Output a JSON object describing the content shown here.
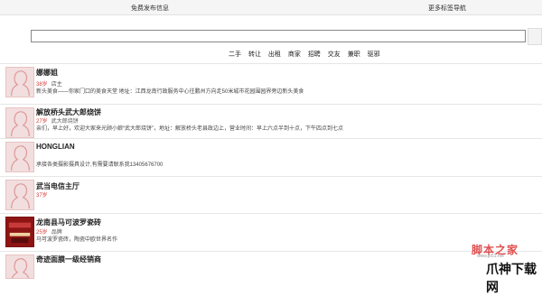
{
  "topbar": {
    "left_link": "免费发布信息",
    "right_link": "更多标签导航"
  },
  "search": {
    "value": "",
    "placeholder": ""
  },
  "categories": [
    "二手",
    "转让",
    "出租",
    "商家",
    "招聘",
    "交友",
    "兼职",
    "驱邪"
  ],
  "items": [
    {
      "title": "娜娜姐",
      "age": "38岁",
      "tag": "店主",
      "desc": "新头美食——你家门口的美食天堂 地址：江西龙南行政服务中心往鹏州方向走50米城市花园围园界旁边新头美食",
      "avatar": "female-silhouette"
    },
    {
      "title": "解放桥头武大郎烧饼",
      "age": "27岁",
      "tag": "武大郎烧饼",
      "desc": "亲们，早上好，欢迎大家来光顾小娘“武大郎烧饼”，地址：解放桥头老县政边上，营业时间：早上六点半到十点，下午四点到七点",
      "avatar": "female-silhouette"
    },
    {
      "title": "HONGLIAN",
      "age": "",
      "tag": "",
      "desc": "承接各类摄影摄具设计,有需要请联系我13405676700",
      "avatar": "female-silhouette"
    },
    {
      "title": "武当电信主厅",
      "age": "37岁",
      "tag": "",
      "desc": "",
      "avatar": "female-silhouette"
    },
    {
      "title": "龙南县马可波罗瓷砖",
      "age": "25岁",
      "tag": "品牌",
      "desc": "马可波罗瓷砖，陶瓷中欧世界名作",
      "avatar": "shop-photo"
    },
    {
      "title": "奇迹面膜一级经销商",
      "age": "",
      "tag": "",
      "desc": "",
      "avatar": "female-silhouette"
    }
  ],
  "watermarks": {
    "site1": "脚本之家",
    "site1_url": "www.jb51.net",
    "site2": "爪神下载网"
  }
}
